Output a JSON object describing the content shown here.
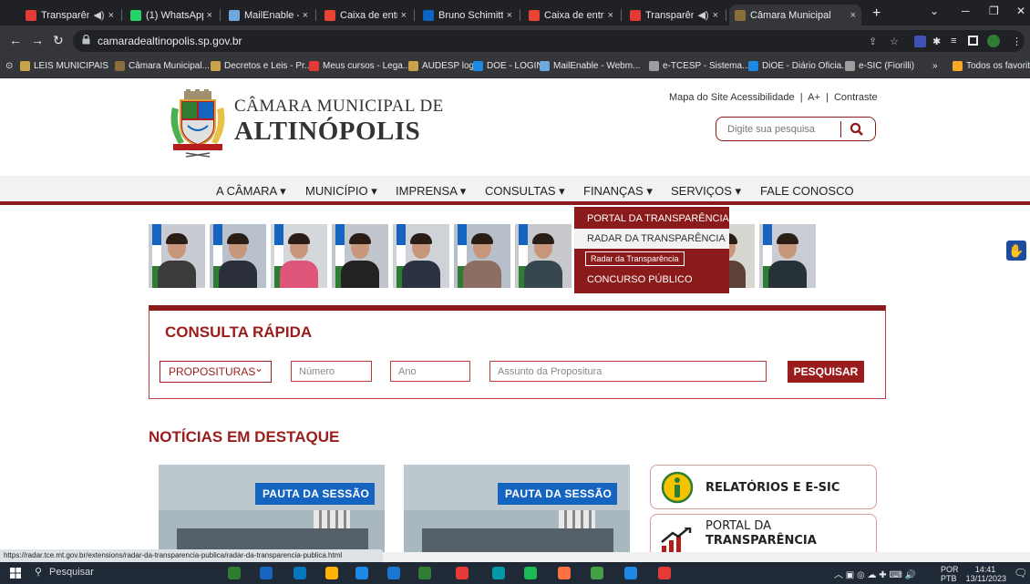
{
  "browser": {
    "tabs": [
      {
        "title": "Transparência",
        "color": "#e53935",
        "audio": true,
        "active": false
      },
      {
        "title": "(1) WhatsApp",
        "color": "#25d366",
        "audio": false,
        "active": false
      },
      {
        "title": "MailEnable - Web",
        "color": "#6fa8dc",
        "audio": false,
        "active": false
      },
      {
        "title": "Caixa de entrada (",
        "color": "#ea4335",
        "audio": false,
        "active": false
      },
      {
        "title": "Bruno Schimitt Me",
        "color": "#0a66c2",
        "audio": false,
        "active": false
      },
      {
        "title": "Caixa de entrada (",
        "color": "#ea4335",
        "audio": false,
        "active": false
      },
      {
        "title": "Transparência",
        "color": "#e53935",
        "audio": true,
        "active": false
      },
      {
        "title": "Câmara Municipal",
        "color": "#8b6e3c",
        "audio": false,
        "active": true
      }
    ],
    "audio_glyph": "◀)",
    "close_glyph": "×",
    "new_tab": "+",
    "url": "camaradealtinopolis.sp.gov.br",
    "bookmarks": [
      {
        "label": "LEIS MUNICIPAIS",
        "color": "#c9a24a"
      },
      {
        "label": "Câmara Municipal...",
        "color": "#8b6e3c"
      },
      {
        "label": "Decretos e Leis - Pr...",
        "color": "#c9a24a"
      },
      {
        "label": "Meus cursos - Lega...",
        "color": "#e53935"
      },
      {
        "label": "AUDESP login",
        "color": "#c9a24a"
      },
      {
        "label": "DOE - LOGIN",
        "color": "#1e88e5"
      },
      {
        "label": "MailEnable - Webm...",
        "color": "#6fa8dc"
      },
      {
        "label": "e-TCESP - Sistema...",
        "color": "#9e9e9e"
      },
      {
        "label": "DiOE - Diário Oficia...",
        "color": "#1e88e5"
      },
      {
        "label": "e-SIC (Fiorilli)",
        "color": "#9e9e9e"
      }
    ],
    "more_bookmarks": "»",
    "all_favorites": "Todos os favoritos",
    "status_url": "https://radar.tce.mt.gov.br/extensions/radar-da-transparencia-publica/radar-da-transparencia-publica.html"
  },
  "site": {
    "brand_line1": "CÂMARA MUNICIPAL DE",
    "brand_line2": "ALTINÓPOLIS",
    "top_links": [
      "Mapa do Site",
      "Acessibilidade",
      "A+",
      "Contraste"
    ],
    "top_sep": "|",
    "search_placeholder": "Digite sua pesquisa",
    "nav": [
      "A CÂMARA ▾",
      "MUNICÍPIO ▾",
      "IMPRENSA ▾",
      "CONSULTAS ▾",
      "FINANÇAS ▾",
      "SERVIÇOS ▾",
      "FALE CONOSCO"
    ],
    "dropdown": [
      "PORTAL DA TRANSPARÊNCIA",
      "RADAR DA TRANSPARÊNCIA",
      "CONCURSO PÚBLICO"
    ],
    "tooltip": "Radar da Transparência",
    "accessibility_glyph": "✋"
  },
  "quick_search": {
    "title": "CONSULTA RÁPIDA",
    "select_value": "PROPOSITURAS",
    "select_arrow": "⌄",
    "numero_placeholder": "Número",
    "ano_placeholder": "Ano",
    "assunto_placeholder": "Assunto da Propositura",
    "button": "PESQUISAR"
  },
  "news": {
    "heading": "NOTÍCIAS EM DESTAQUE",
    "items": [
      {
        "badge": "PAUTA DA SESSÃO"
      },
      {
        "badge": "PAUTA DA SESSÃO"
      }
    ],
    "cards": [
      {
        "label": "RELATÓRIOS E E-SIC",
        "label2": ""
      },
      {
        "label": "PORTAL DA",
        "label2": "TRANSPARÊNCIA"
      }
    ]
  },
  "taskbar": {
    "search_placeholder": "Pesquisar",
    "lang1": "POR",
    "lang2": "PTB",
    "time": "14:41",
    "date": "13/11/2023",
    "apps": [
      "#2e7d32",
      "#1565c0",
      "#0277bd",
      "#ffb300",
      "#1e88e5",
      "#1976d2",
      "#2e7d32",
      "#e53935",
      "#0097a7",
      "#1db954",
      "#ff7043",
      "#43a047",
      "#1e88e5",
      "#e53935"
    ]
  },
  "colors": {
    "brand": "#8b1a1a",
    "accent": "#9b1c1c"
  }
}
